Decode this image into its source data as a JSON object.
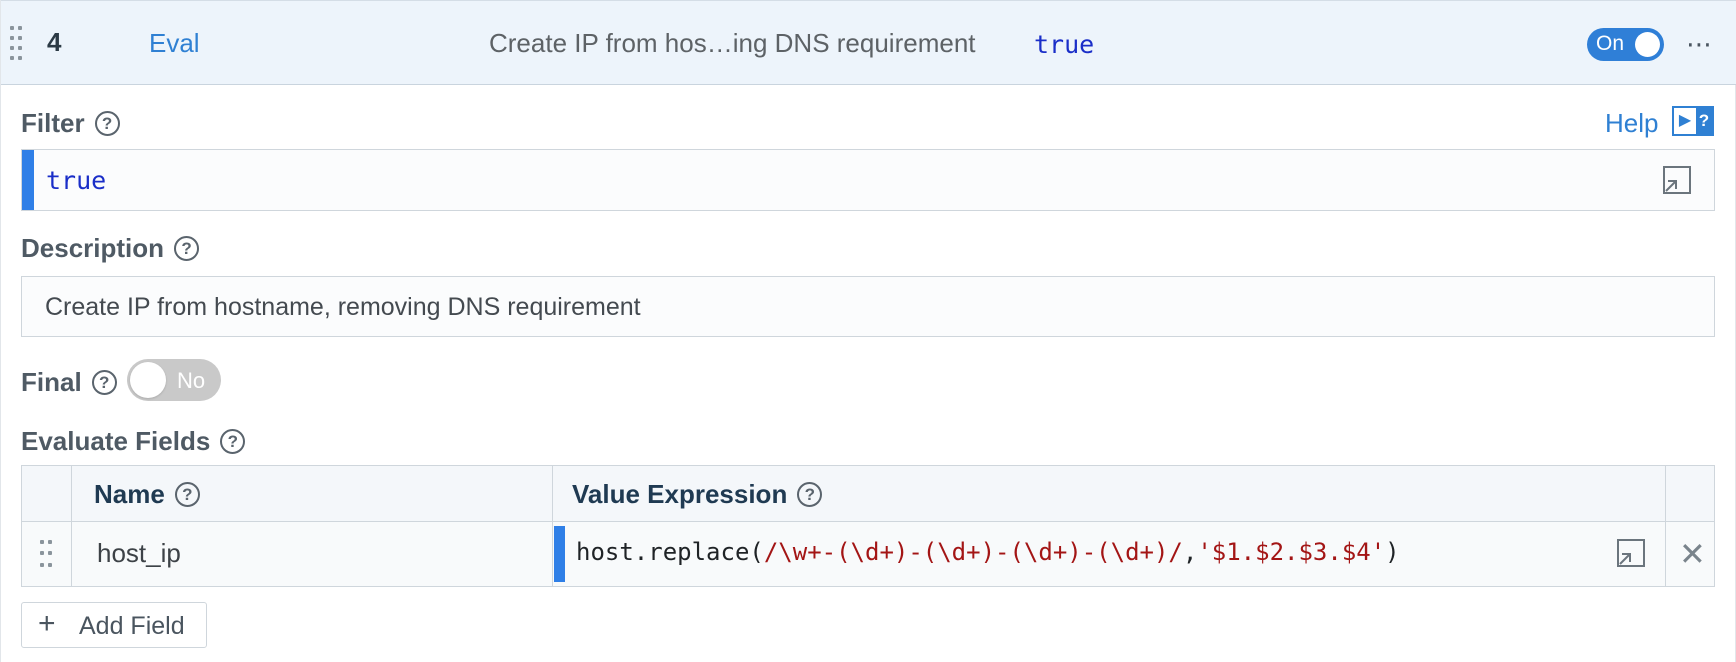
{
  "header": {
    "index": "4",
    "function": "Eval",
    "description": "Create IP from hos…ing DNS requirement",
    "filter": "true",
    "toggle_label": "On",
    "more": "⋯"
  },
  "filter": {
    "label": "Filter",
    "value": "true",
    "help_link": "Help"
  },
  "description": {
    "label": "Description",
    "value": "Create IP from hostname, removing DNS requirement"
  },
  "final": {
    "label": "Final",
    "toggle_label": "No"
  },
  "evaluate_fields": {
    "label": "Evaluate Fields",
    "columns": [
      "Name",
      "Value Expression"
    ],
    "rows": [
      {
        "name": "host_ip",
        "expr_fn": "host.replace(",
        "expr_regex": "/\\w+-(\\d+)-(\\d+)-(\\d+)-(\\d+)/",
        "expr_comma": ",",
        "expr_str": "'$1.$2.$3.$4'",
        "expr_close": ")"
      }
    ],
    "add_label": "Add Field"
  },
  "colors": {
    "accent": "#2f7fe7",
    "link": "#2f80d3",
    "keyword": "#1a2ec8",
    "regex": "#a31515"
  }
}
